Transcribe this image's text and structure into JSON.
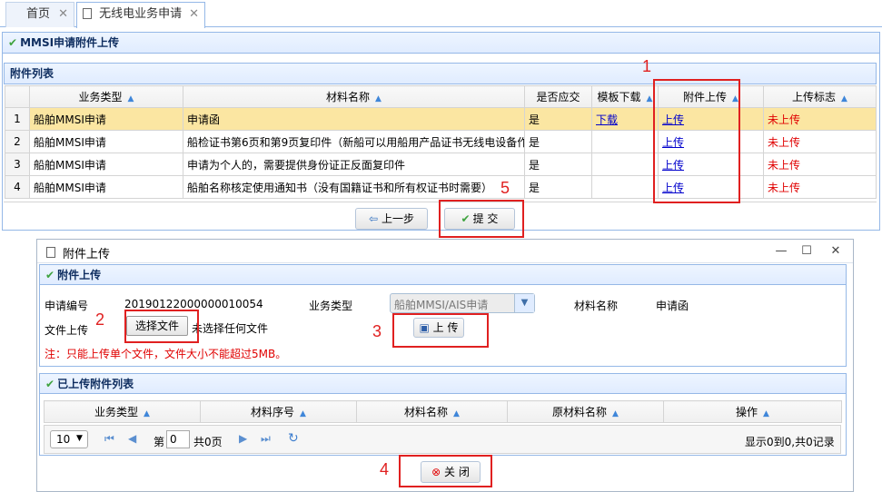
{
  "tabs": [
    {
      "label": "首页",
      "close": "✕"
    },
    {
      "label": "无线电业务申请",
      "close": "✕"
    }
  ],
  "main": {
    "panel_title": "MMSI申请附件上传",
    "section_title": "附件列表",
    "columns": [
      "业务类型",
      "材料名称",
      "是否应交",
      "模板下载",
      "附件上传",
      "上传标志"
    ],
    "rows": [
      {
        "n": "1",
        "type": "船舶MMSI申请",
        "name": "申请函",
        "required": "是",
        "download": "下载",
        "upload": "上传",
        "flag": "未上传"
      },
      {
        "n": "2",
        "type": "船舶MMSI申请",
        "name": "船检证书第6页和第9页复印件（新船可以用船用产品证书无线电设备作",
        "required": "是",
        "download": "",
        "upload": "上传",
        "flag": "未上传"
      },
      {
        "n": "3",
        "type": "船舶MMSI申请",
        "name": "申请为个人的，需要提供身份证正反面复印件",
        "required": "是",
        "download": "",
        "upload": "上传",
        "flag": "未上传"
      },
      {
        "n": "4",
        "type": "船舶MMSI申请",
        "name": "船舶名称核定使用通知书（没有国籍证书和所有权证书时需要）",
        "required": "是",
        "download": "",
        "upload": "上传",
        "flag": "未上传"
      }
    ],
    "prev_label": "上一步",
    "submit_label": "提 交"
  },
  "dialog": {
    "title": "附件上传",
    "win_min": "—",
    "win_max": "☐",
    "win_close": "✕",
    "panel_title": "附件上传",
    "app_no_label": "申请编号",
    "app_no": "20190122000000010054",
    "biz_type_label": "业务类型",
    "biz_type_value": "船舶MMSI/AIS申请",
    "material_label": "材料名称",
    "material_value": "申请函",
    "file_label": "文件上传",
    "choose_file": "选择文件",
    "no_file": "未选择任何文件",
    "upload_label": "上 传",
    "note": "注：只能上传单个文件，文件大小不能超过5MB。",
    "uploaded_title": "已上传附件列表",
    "uploaded_columns": [
      "业务类型",
      "材料序号",
      "材料名称",
      "原材料名称",
      "操作"
    ],
    "page_size": "10",
    "page_prefix": "第",
    "page_value": "0",
    "page_total": "共0页",
    "page_info": "显示0到0,共0记录",
    "close_label": "关 闭"
  },
  "annotations": [
    "1",
    "2",
    "3",
    "4",
    "5"
  ]
}
